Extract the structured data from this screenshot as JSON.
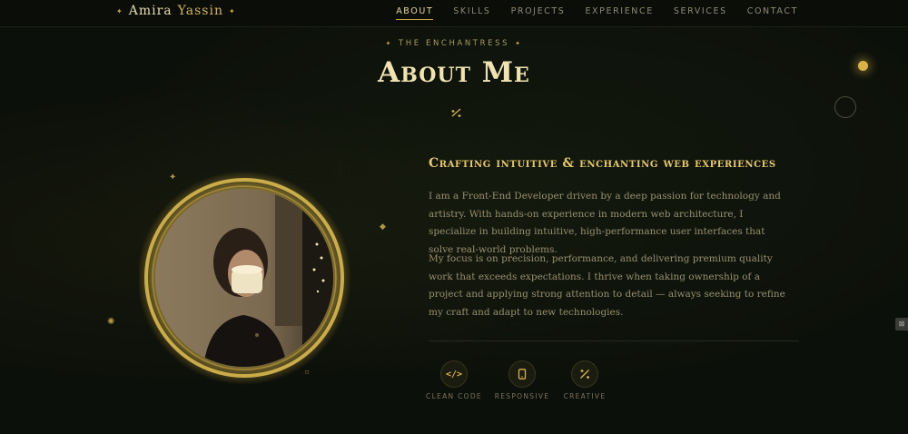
{
  "nav": {
    "brand_first": "Amira",
    "brand_last": "Yassin",
    "links": [
      {
        "label": "ABOUT",
        "active": true
      },
      {
        "label": "SKILLS",
        "active": false
      },
      {
        "label": "PROJECTS",
        "active": false
      },
      {
        "label": "EXPERIENCE",
        "active": false
      },
      {
        "label": "SERVICES",
        "active": false
      },
      {
        "label": "CONTACT",
        "active": false
      }
    ]
  },
  "header": {
    "eyebrow": "THE ENCHANTRESS",
    "title": "About Me"
  },
  "about": {
    "subhead": "Crafting intuitive & enchanting web experiences",
    "paragraphs": [
      "I am a Front-End Developer driven by a deep passion for technology and artistry. With hands-on experience in modern web architecture, I specialize in building intuitive, high-performance user interfaces that solve real-world problems.",
      "My focus is on precision, performance, and delivering premium quality work that exceeds expectations. I thrive when taking ownership of a project and applying strong attention to detail — always seeking to refine my craft and adapt to new technologies."
    ],
    "features": [
      {
        "label": "CLEAN CODE",
        "icon": "code-icon",
        "glyph": "</>"
      },
      {
        "label": "RESPONSIVE",
        "icon": "mobile-icon",
        "glyph": "▯"
      },
      {
        "label": "CREATIVE",
        "icon": "magic-wand-icon",
        "glyph": "⁒"
      }
    ]
  },
  "colors": {
    "accent": "#d9b248",
    "background": "#0c100a",
    "title": "#f1e3b0"
  }
}
